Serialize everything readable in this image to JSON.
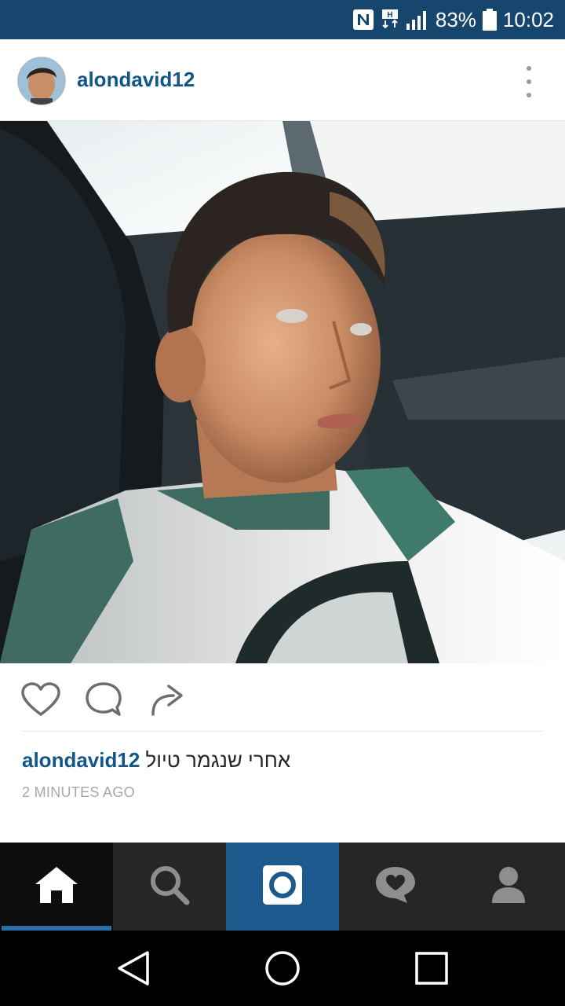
{
  "status_bar": {
    "battery": "83%",
    "time": "10:02",
    "icons": [
      "nfc-icon",
      "data-transfer-icon",
      "signal-icon",
      "battery-icon"
    ]
  },
  "post": {
    "username": "alondavid12",
    "caption_user": "alondavid12",
    "caption_text": "אחרי שנגמר טיול",
    "timestamp": "2 MINUTES AGO"
  },
  "actions": [
    "heart-icon",
    "comment-icon",
    "share-icon"
  ],
  "tabs": [
    "home-icon",
    "search-icon",
    "camera-icon",
    "activity-icon",
    "profile-icon"
  ],
  "nav": [
    "back-icon",
    "home-circle-icon",
    "recents-icon"
  ],
  "colors": {
    "status_bar": "#16466e",
    "username": "#125688",
    "tab_active": "#1c5a8e"
  }
}
